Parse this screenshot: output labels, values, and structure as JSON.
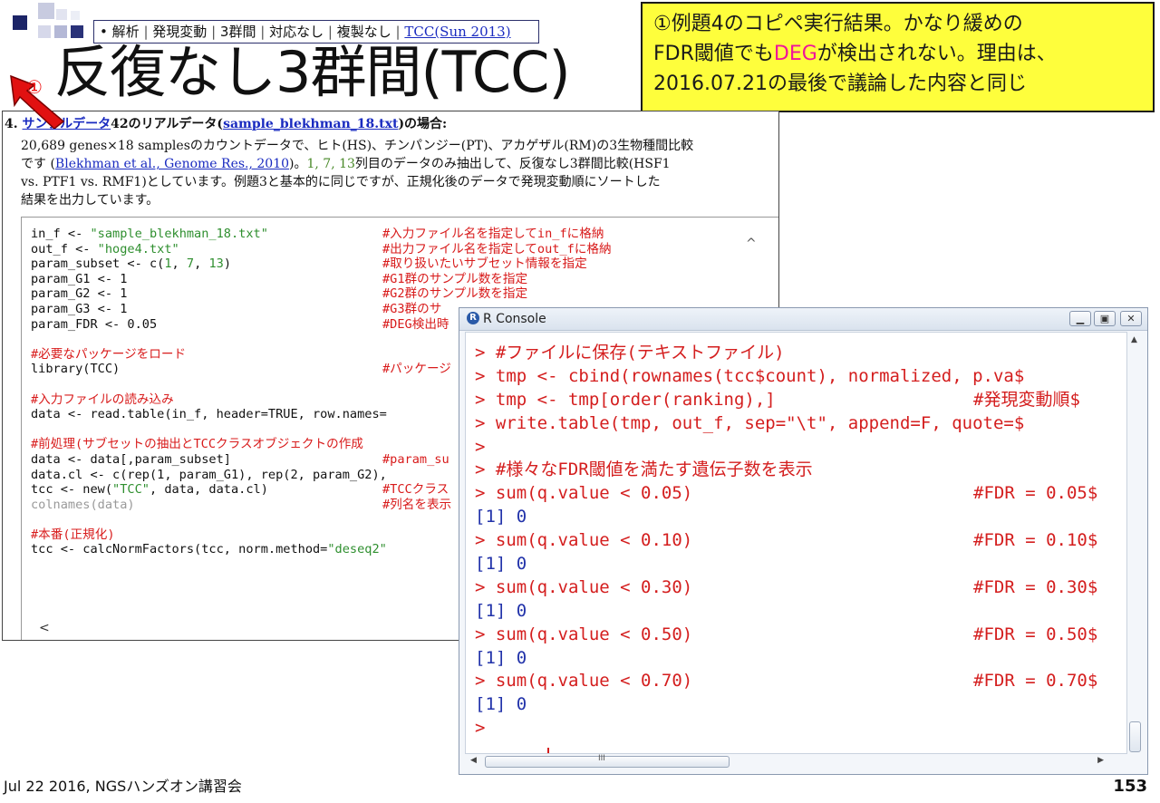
{
  "breadcrumb": {
    "items": [
      "解析",
      "発現変動",
      "3群間",
      "対応なし",
      "複製なし"
    ],
    "bullet": "•",
    "sep": "|",
    "link": "TCC(Sun 2013)"
  },
  "slide_title": "反復なし3群間(TCC)",
  "annotation_badge": "①",
  "note": {
    "line1": "①例題4のコピペ実行結果。かなり緩めの",
    "line2_pre": "FDR閾値でも",
    "line2_hl": "DEG",
    "line2_post": "が検出されない。理由は、",
    "line3": "2016.07.21の最後で議論した内容と同じ"
  },
  "document": {
    "heading_num": "4.",
    "heading_link": "サンプルデータ",
    "heading_mid": "42のリアルデータ(",
    "heading_file": "sample_blekhman_18.txt",
    "heading_post": ")の場合:",
    "para_line1": "20,689 genes×18 samplesのカウントデータで、ヒト(HS)、チンパンジー(PT)、アカゲザル(RM)の3生物種間比較",
    "para_line2_pre": "です (",
    "para_line2_link": "Blekhman et al., Genome Res., 2010",
    "para_line2_mid": ")。",
    "para_line2_cols": "1, 7, 13",
    "para_line2_post": "列目のデータのみ抽出して、反復なし3群間比較(HSF1",
    "para_line3": "vs. PTF1 vs. RMF1)としています。例題3と基本的に同じですが、正規化後のデータで発現変動順にソートした",
    "para_line4": "結果を出力しています。",
    "code": [
      {
        "code": "in_f <- \"sample_blekhman_18.txt\"",
        "comment": "#入力ファイル名を指定してin_fに格納"
      },
      {
        "code": "out_f <- \"hoge4.txt\"",
        "comment": "#出力ファイル名を指定してout_fに格納"
      },
      {
        "code": "param_subset <- c(1, 7, 13)",
        "comment": "#取り扱いたいサブセット情報を指定"
      },
      {
        "code": "param_G1 <- 1",
        "comment": "#G1群のサンプル数を指定"
      },
      {
        "code": "param_G2 <- 1",
        "comment": "#G2群のサンプル数を指定"
      },
      {
        "code": "param_G3 <- 1",
        "comment": "#G3群のサ"
      },
      {
        "code": "param_FDR <- 0.05",
        "comment": "#DEG検出時"
      },
      {
        "code": "",
        "comment": ""
      },
      {
        "code": "#必要なパッケージをロード",
        "comment": ""
      },
      {
        "code": "library(TCC)",
        "comment": "#パッケージ"
      },
      {
        "code": "",
        "comment": ""
      },
      {
        "code": "#入力ファイルの読み込み",
        "comment": ""
      },
      {
        "code": "data <- read.table(in_f, header=TRUE, row.names=",
        "comment": ""
      },
      {
        "code": "",
        "comment": ""
      },
      {
        "code": "#前処理(サブセットの抽出とTCCクラスオブジェクトの作成",
        "comment": ""
      },
      {
        "code": "data <- data[,param_subset]",
        "comment": "#param_su"
      },
      {
        "code": "data.cl <- c(rep(1, param_G1), rep(2, param_G2),",
        "comment": ""
      },
      {
        "code": "tcc <- new(\"TCC\", data, data.cl)",
        "comment": "#TCCクラス"
      },
      {
        "code": "colnames(data)",
        "comment": "#列名を表示"
      },
      {
        "code": "",
        "comment": ""
      },
      {
        "code": "#本番(正規化)",
        "comment": ""
      },
      {
        "code": "tcc <- calcNormFactors(tcc, norm.method=\"deseq2\"",
        "comment": ""
      }
    ]
  },
  "rconsole": {
    "title": "R Console",
    "logo": "R",
    "lines": [
      {
        "text": "> #ファイルに保存(テキストファイル)",
        "comment": "",
        "kind": "in"
      },
      {
        "text": "> tmp <- cbind(rownames(tcc$count), normalized, p.va$",
        "comment": "",
        "kind": "in"
      },
      {
        "text": "> tmp <- tmp[order(ranking),]",
        "comment": "#発現変動順$",
        "kind": "in"
      },
      {
        "text": "> write.table(tmp, out_f, sep=\"\\t\", append=F, quote=$",
        "comment": "",
        "kind": "in"
      },
      {
        "text": ">",
        "comment": "",
        "kind": "in"
      },
      {
        "text": "> #様々なFDR閾値を満たす遺伝子数を表示",
        "comment": "",
        "kind": "in"
      },
      {
        "text": "> sum(q.value < 0.05)",
        "comment": "#FDR = 0.05$",
        "kind": "in"
      },
      {
        "text": "[1] 0",
        "comment": "",
        "kind": "out"
      },
      {
        "text": "> sum(q.value < 0.10)",
        "comment": "#FDR = 0.10$",
        "kind": "in"
      },
      {
        "text": "[1] 0",
        "comment": "",
        "kind": "out"
      },
      {
        "text": "> sum(q.value < 0.30)",
        "comment": "#FDR = 0.30$",
        "kind": "in"
      },
      {
        "text": "[1] 0",
        "comment": "",
        "kind": "out"
      },
      {
        "text": "> sum(q.value < 0.50)",
        "comment": "#FDR = 0.50$",
        "kind": "in"
      },
      {
        "text": "[1] 0",
        "comment": "",
        "kind": "out"
      },
      {
        "text": "> sum(q.value < 0.70)",
        "comment": "#FDR = 0.70$",
        "kind": "in"
      },
      {
        "text": "[1] 0",
        "comment": "",
        "kind": "out"
      },
      {
        "text": ">",
        "comment": "",
        "kind": "in"
      }
    ],
    "scroll_mark": "III"
  },
  "footer": {
    "date_event": "Jul 22 2016, NGSハンズオン講習会",
    "page_number": "153"
  },
  "colors": {
    "note_bg": "#fefe3c",
    "highlight": "#f0149a",
    "console_text": "#d41e1e",
    "console_output": "#2233aa",
    "link": "#1a2bc0",
    "arrow": "#e11111"
  }
}
